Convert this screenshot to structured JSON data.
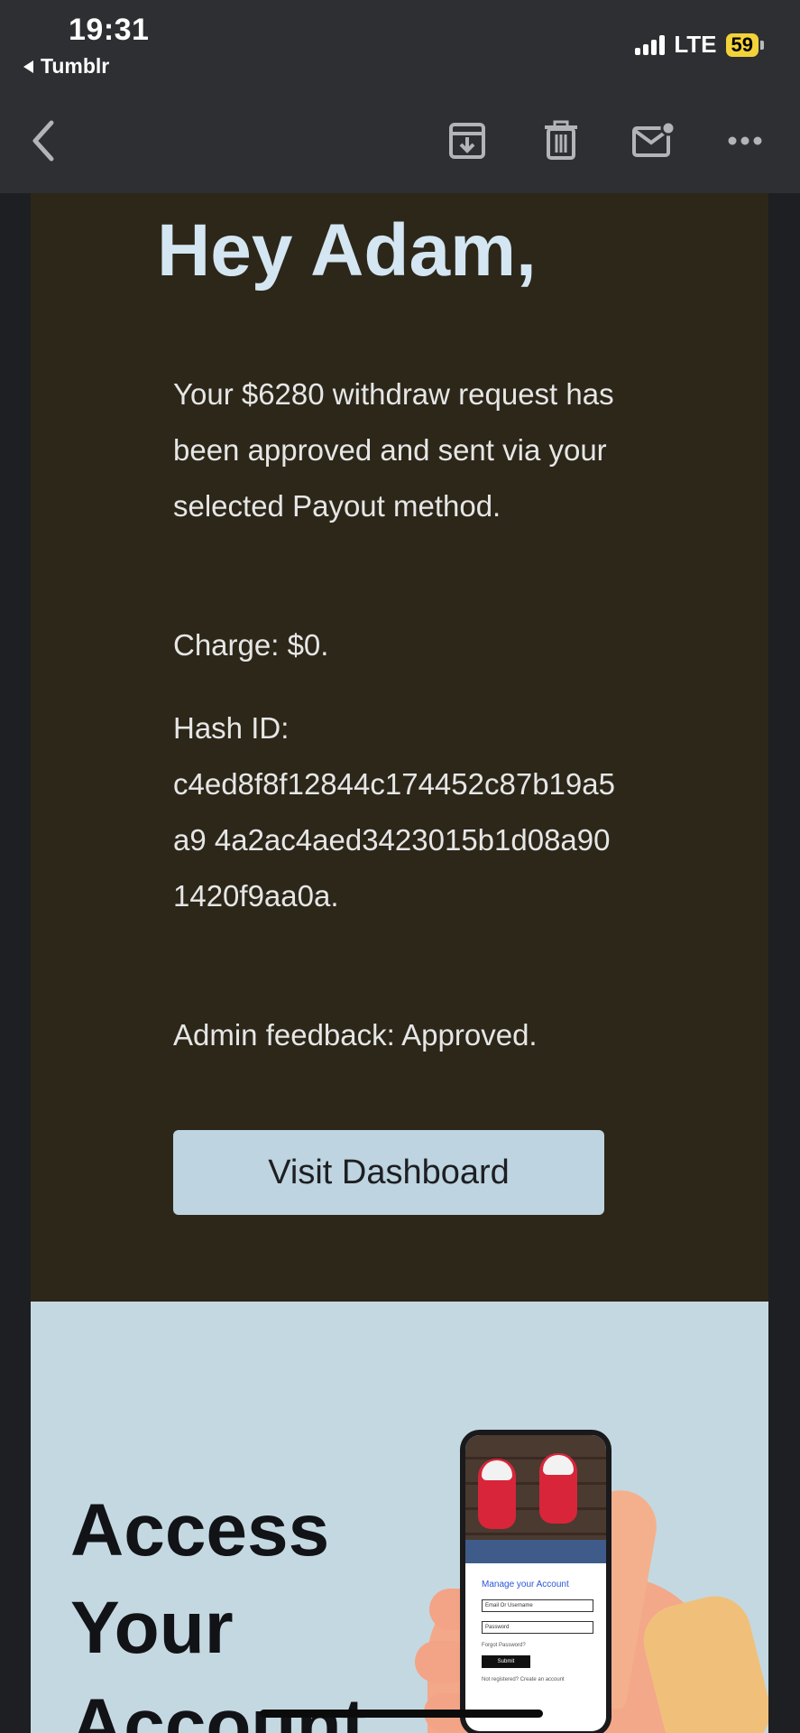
{
  "status_bar": {
    "time": "19:31",
    "back_app": "Tumblr",
    "network": "LTE",
    "battery": "59"
  },
  "toolbar": {
    "icons": [
      "back-chevron-icon",
      "archive-icon",
      "trash-icon",
      "mark-unread-icon",
      "more-icon"
    ]
  },
  "email": {
    "greeting": "Hey Adam,",
    "message": "Your $6280 withdraw request has been approved and sent via your selected Payout method.",
    "charge": "Charge: $0.",
    "hash_label": "Hash ID:",
    "hash_value": "c4ed8f8f12844c174452c87b19a5a9 4a2ac4aed3423015b1d08a901420f9aa0a.",
    "feedback": "Admin feedback: Approved.",
    "button_label": "Visit Dashboard",
    "access_title": "Access Your Account"
  },
  "illustration": {
    "title": "Manage your Account",
    "field1": "Email Or Username",
    "field2": "Password",
    "forgot": "Forgot Password?",
    "submit": "Submit",
    "register": "Not registered? Create an account"
  },
  "colors": {
    "chrome": "#2e2f33",
    "email_dark": "#2c2719",
    "greeting": "#d4e6f2",
    "button_bg": "#bed4e0",
    "email_light": "#c4d8e1",
    "battery": "#f2d33a"
  }
}
